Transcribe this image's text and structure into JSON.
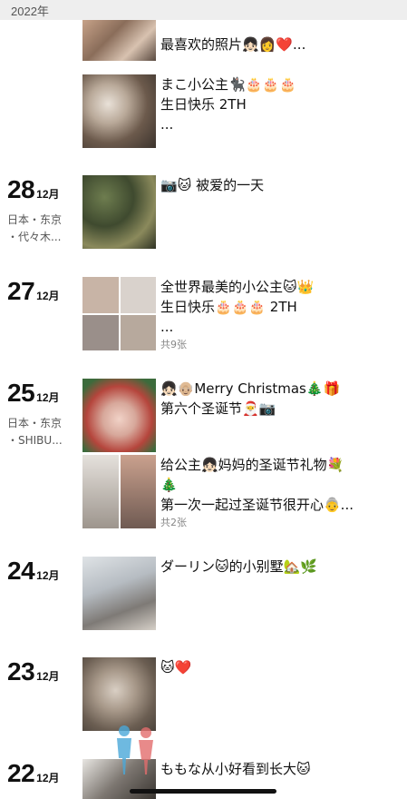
{
  "header": {
    "year": "2022年"
  },
  "days": [
    {
      "posts": [
        {
          "text": "最喜欢的照片👧🏻👩❤️...",
          "photo_count": ""
        },
        {
          "text": "まこ小公主🐈‍⬛🎂🎂🎂\n生日快乐 2TH\n...",
          "photo_count": ""
        }
      ]
    },
    {
      "day": "28",
      "month": "12月",
      "location": [
        "日本・东京",
        "・代々木..."
      ],
      "posts": [
        {
          "text": "📷🐱 被爱的一天",
          "photo_count": ""
        }
      ]
    },
    {
      "day": "27",
      "month": "12月",
      "location": [],
      "posts": [
        {
          "text": "全世界最美的小公主🐱👑\n生日快乐🎂🎂🎂 2TH\n...",
          "photo_count": "共9张"
        }
      ]
    },
    {
      "day": "25",
      "month": "12月",
      "location": [
        "日本・东京",
        "・SHIBU..."
      ],
      "posts": [
        {
          "text": "👧🏻👴🏼Merry Christmas🎄🎁\n第六个圣诞节🎅📷",
          "photo_count": ""
        },
        {
          "text": "给公主👧🏻妈妈的圣诞节礼物💐\n🎄\n第一次一起过圣诞节很开心👵...",
          "photo_count": "共2张"
        }
      ]
    },
    {
      "day": "24",
      "month": "12月",
      "location": [],
      "posts": [
        {
          "text": "ダーリン🐱的小别墅🏡🌿",
          "photo_count": ""
        }
      ]
    },
    {
      "day": "23",
      "month": "12月",
      "location": [],
      "posts": [
        {
          "text": "🐱❤️",
          "photo_count": ""
        }
      ]
    },
    {
      "day": "22",
      "month": "12月",
      "location": [],
      "posts": [
        {
          "text": "ももな从小好看到长大🐱",
          "photo_count": ""
        }
      ]
    }
  ],
  "colors": {
    "background": "#ffffff",
    "year_bar": "#eeeeee",
    "muted_text": "#888888"
  }
}
